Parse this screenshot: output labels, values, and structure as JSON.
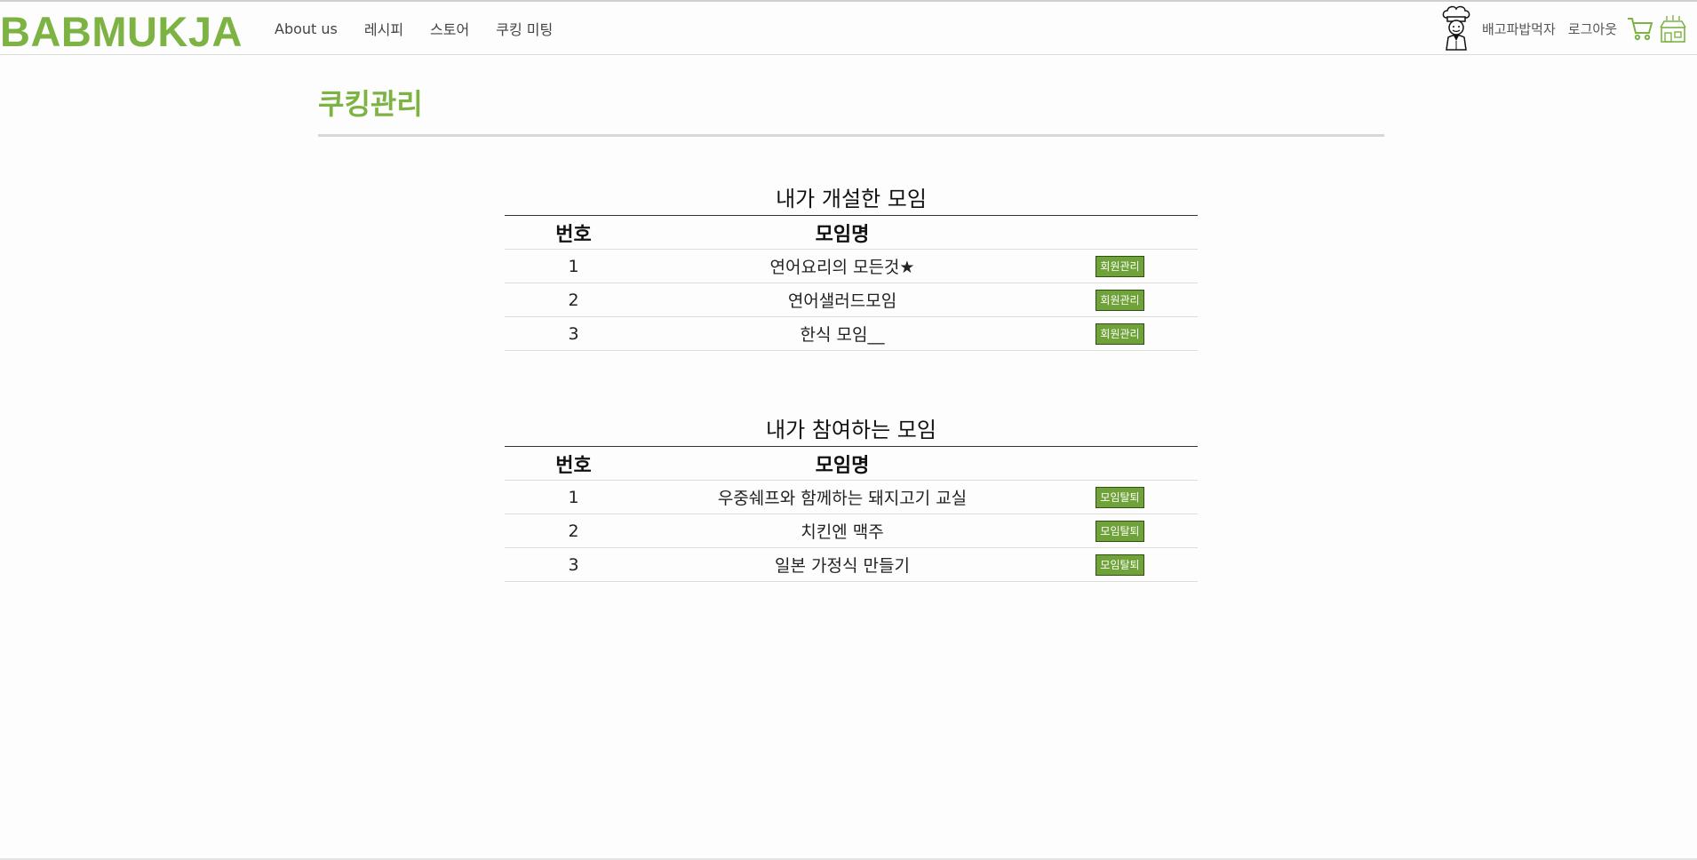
{
  "header": {
    "logo": "BABMUKJA",
    "nav": [
      "About us",
      "레시피",
      "스토어",
      "쿠킹 미팅"
    ],
    "user_name": "배고파밥먹자",
    "logout": "로그아웃"
  },
  "page": {
    "title": "쿠킹관리"
  },
  "hosted": {
    "title": "내가 개설한 모임",
    "headers": [
      "번호",
      "모임명",
      ""
    ],
    "rows": [
      {
        "no": "1",
        "name": "연어요리의 모든것★",
        "action": "회원관리"
      },
      {
        "no": "2",
        "name": "연어샐러드모임",
        "action": "회원관리"
      },
      {
        "no": "3",
        "name": "한식 모임__",
        "action": "회원관리"
      }
    ]
  },
  "joined": {
    "title": "내가 참여하는 모임",
    "headers": [
      "번호",
      "모임명",
      ""
    ],
    "rows": [
      {
        "no": "1",
        "name": "우중쉐프와 함께하는 돼지고기 교실",
        "action": "모임탈퇴"
      },
      {
        "no": "2",
        "name": "치킨엔 맥주",
        "action": "모임탈퇴"
      },
      {
        "no": "3",
        "name": "일본 가정식 만들기",
        "action": "모임탈퇴"
      }
    ]
  },
  "colors": {
    "brand": "#7cb342",
    "button": "#6fa33a"
  },
  "icons": [
    "chef-avatar-icon",
    "cart-icon",
    "store-icon"
  ]
}
